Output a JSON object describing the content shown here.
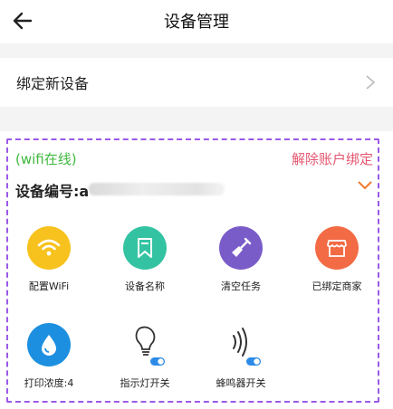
{
  "header": {
    "title": "设备管理"
  },
  "bind_row": {
    "label": "绑定新设备"
  },
  "device": {
    "status": "(wifi在线)",
    "unbind_label": "解除账户绑定",
    "number_label": "设备编号:a"
  },
  "actions": [
    {
      "label": "配置WiFi",
      "icon": "wifi-icon",
      "color": "#f7c21d"
    },
    {
      "label": "设备名称",
      "icon": "bookmark-icon",
      "color": "#34c3a2"
    },
    {
      "label": "清空任务",
      "icon": "broom-icon",
      "color": "#7a5cc9"
    },
    {
      "label": "已绑定商家",
      "icon": "shop-icon",
      "color": "#f26b45"
    },
    {
      "label": "打印浓度:4",
      "icon": "drop-icon",
      "color": "#1d8fe0"
    },
    {
      "label": "指示灯开关",
      "icon": "lightbulb-icon"
    },
    {
      "label": "蜂鸣器开关",
      "icon": "sound-icon"
    }
  ]
}
